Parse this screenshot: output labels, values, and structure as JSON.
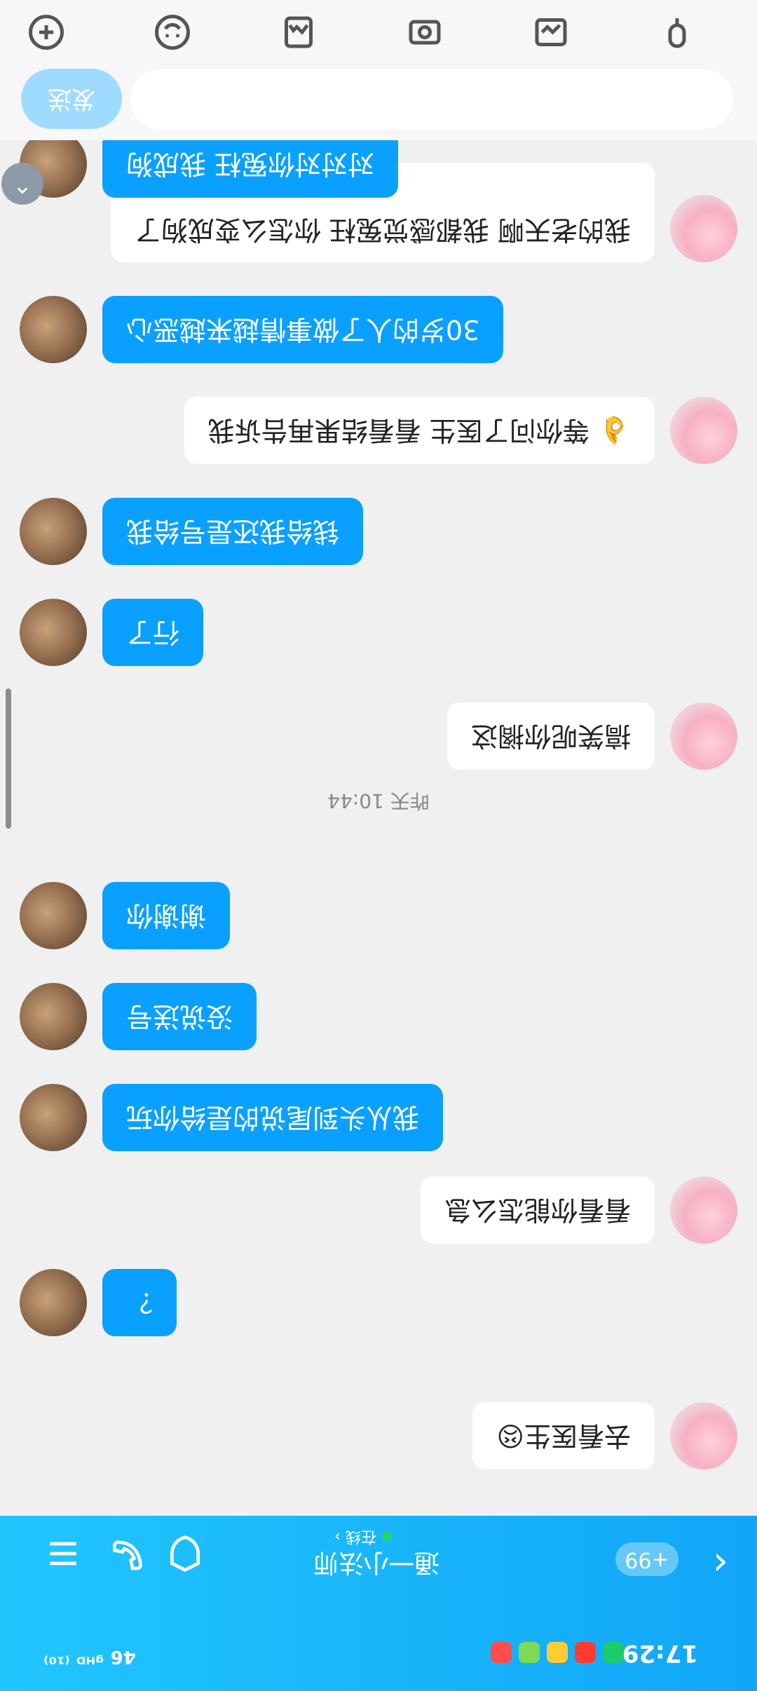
{
  "status_bar": {
    "time": "17:29",
    "right": "46 ᵍᴴᴰ ⁽¹⁰⁾"
  },
  "header": {
    "contact_name": "通一小法师",
    "online_label": "在线 ›",
    "unread_badge": "+99",
    "back_icon": "chevron-left-icon",
    "call_icon": "phone-icon",
    "shield_icon": "shield-icon",
    "menu_icon": "menu-icon"
  },
  "messages": [
    {
      "side": "left",
      "text": "去看医生😣"
    },
    {
      "side": "right",
      "text": "？"
    },
    {
      "side": "left",
      "text": "看看你能怎么急"
    },
    {
      "side": "right",
      "text": "我从头到尾说的是给你玩"
    },
    {
      "side": "right",
      "text": "没说送号"
    },
    {
      "side": "right",
      "text": "谢谢你"
    },
    {
      "side": "time",
      "text": "昨天 10:44"
    },
    {
      "side": "left",
      "text": "搞笑呢你搁这"
    },
    {
      "side": "right",
      "text": "行了"
    },
    {
      "side": "right",
      "text": "钱给我还是号给我"
    },
    {
      "side": "left",
      "text": "👌 等你问了医生 看看结果再告诉我"
    },
    {
      "side": "right",
      "text": "30岁的人了做事情越来越恶心"
    },
    {
      "side": "left",
      "text": "我的老天啊 我都感觉冤枉 你怎么变成狗了"
    },
    {
      "side": "right",
      "text": "对对对你冤枉 我成狗"
    }
  ],
  "input_bar": {
    "send_label": "发送",
    "placeholder": ""
  },
  "tools": [
    "mic-icon",
    "image-edit-icon",
    "photo-camera-icon",
    "image-icon",
    "emoji-icon",
    "plus-icon"
  ]
}
